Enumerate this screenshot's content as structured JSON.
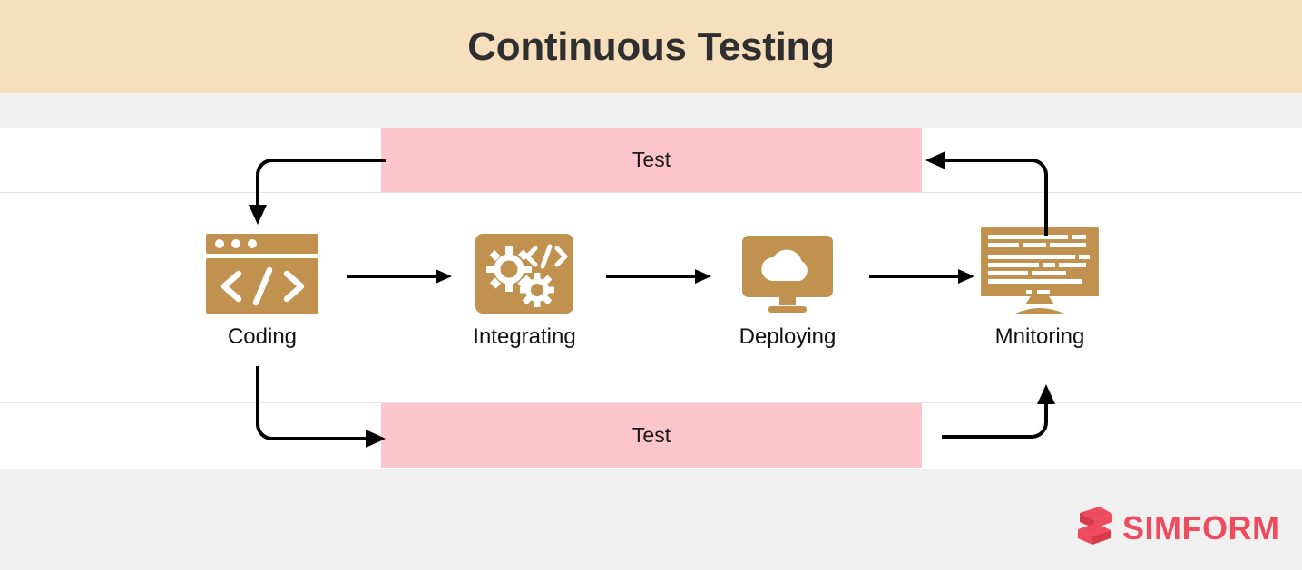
{
  "banner": {
    "title": "Continuous Testing",
    "bg_color": "#f6dfbd",
    "text_color": "#2f2f2f"
  },
  "colors": {
    "icon_tan": "#c0914f",
    "test_pink": "#fcc5cb",
    "band_gray": "#f0f0f0",
    "arrow_black": "#000000",
    "logo_red": "#ee4b5e"
  },
  "test_bars": [
    {
      "label": "Test",
      "position": "top"
    },
    {
      "label": "Test",
      "position": "bottom"
    }
  ],
  "stages": [
    {
      "label": "Coding",
      "icon": "code-window-icon"
    },
    {
      "label": "Integrating",
      "icon": "gears-code-icon"
    },
    {
      "label": "Deploying",
      "icon": "cloud-monitor-icon"
    },
    {
      "label": "Mnitoring",
      "icon": "terminal-monitor-icon"
    }
  ],
  "connectors": [
    {
      "from": "Coding",
      "to": "Integrating",
      "direction": "right"
    },
    {
      "from": "Integrating",
      "to": "Deploying",
      "direction": "right"
    },
    {
      "from": "Deploying",
      "to": "Mnitoring",
      "direction": "right"
    }
  ],
  "feedback_loops": [
    {
      "name": "top-left",
      "from": "Test (top)",
      "to": "Coding",
      "direction": "down"
    },
    {
      "name": "top-right",
      "from": "Mnitoring",
      "to": "Test (top)",
      "direction": "left"
    },
    {
      "name": "bottom-left",
      "from": "Coding",
      "to": "Test (bottom)",
      "direction": "right"
    },
    {
      "name": "bottom-right",
      "from": "Test (bottom)",
      "to": "Mnitoring",
      "direction": "up"
    }
  ],
  "logo": {
    "wordmark": "SIMFORM",
    "mark": "simform-ribbon-icon"
  }
}
